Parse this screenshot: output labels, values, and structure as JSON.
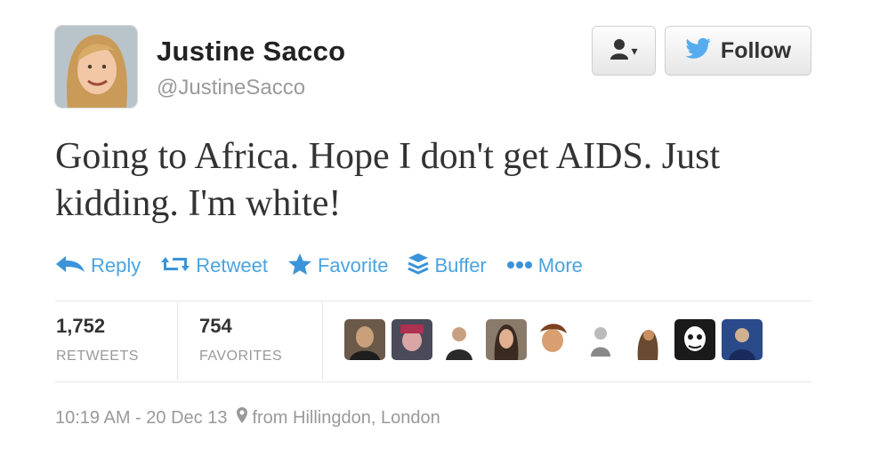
{
  "user": {
    "name": "Justine Sacco",
    "handle": "@JustineSacco"
  },
  "header": {
    "follow_label": "Follow"
  },
  "tweet": {
    "text": "Going to Africa. Hope I don't get AIDS. Just kidding. I'm white!"
  },
  "actions": [
    {
      "label": "Reply",
      "icon": "reply-icon"
    },
    {
      "label": "Retweet",
      "icon": "retweet-icon"
    },
    {
      "label": "Favorite",
      "icon": "star-icon"
    },
    {
      "label": "Buffer",
      "icon": "buffer-icon"
    },
    {
      "label": "More",
      "icon": "more-dots-icon"
    }
  ],
  "stats": {
    "retweets": {
      "count": "1,752",
      "label": "RETWEETS"
    },
    "favorites": {
      "count": "754",
      "label": "FAVORITES"
    }
  },
  "favoriters_count_shown": 9,
  "footer": {
    "timestamp": "10:19 AM - 20 Dec 13",
    "location": "from Hillingdon, London"
  },
  "colors": {
    "accent": "#3b94d9",
    "twitter_blue": "#55acee",
    "text": "#333333",
    "muted": "#999999"
  }
}
